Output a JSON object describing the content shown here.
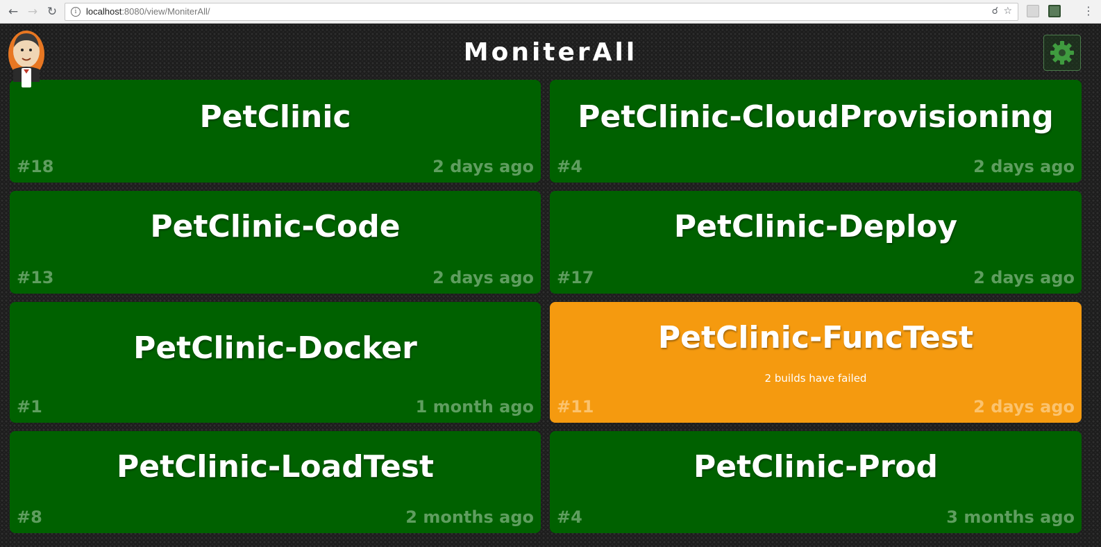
{
  "browser": {
    "url_host": "localhost",
    "url_path": ":8080/view/MoniterAll/"
  },
  "view": {
    "title": "MoniterAll"
  },
  "colors": {
    "success": "#006100",
    "unstable": "#f59a0f",
    "background": "#1c1c1c"
  },
  "icons": {
    "settings": "gear-icon",
    "logo": "jenkins-logo"
  },
  "jobs": [
    {
      "name": "PetClinic",
      "build": "#18",
      "age": "2 days ago",
      "status": "success",
      "message": ""
    },
    {
      "name": "PetClinic-CloudProvisioning",
      "build": "#4",
      "age": "2 days ago",
      "status": "success",
      "message": ""
    },
    {
      "name": "PetClinic-Code",
      "build": "#13",
      "age": "2 days ago",
      "status": "success",
      "message": ""
    },
    {
      "name": "PetClinic-Deploy",
      "build": "#17",
      "age": "2 days ago",
      "status": "success",
      "message": ""
    },
    {
      "name": "PetClinic-Docker",
      "build": "#1",
      "age": "1 month ago",
      "status": "success",
      "message": ""
    },
    {
      "name": "PetClinic-FuncTest",
      "build": "#11",
      "age": "2 days ago",
      "status": "unstable",
      "message": "2 builds have failed"
    },
    {
      "name": "PetClinic-LoadTest",
      "build": "#8",
      "age": "2 months ago",
      "status": "success",
      "message": ""
    },
    {
      "name": "PetClinic-Prod",
      "build": "#4",
      "age": "3 months ago",
      "status": "success",
      "message": ""
    }
  ]
}
